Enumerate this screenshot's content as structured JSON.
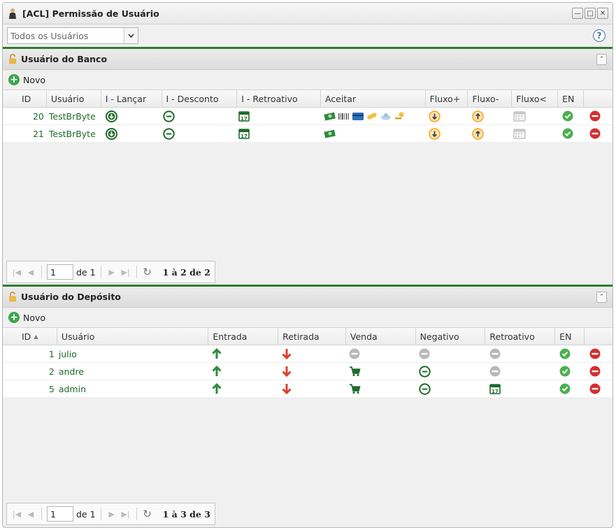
{
  "window": {
    "title": "[ACL] Permissão de Usuário",
    "icons": [
      "user-icon",
      "minimize-icon",
      "maximize-icon",
      "close-icon"
    ]
  },
  "toolbar": {
    "user_select_value": "Todos os Usuários",
    "help_label": "?"
  },
  "bank_panel": {
    "title": "Usuário do Banco",
    "new_label": "Novo",
    "columns": [
      "ID",
      "Usuário",
      "I - Lançar",
      "I - Desconto",
      "I - Retroativo",
      "Aceitar",
      "Fluxo+",
      "Fluxo-",
      "Fluxo<",
      "EN",
      ""
    ],
    "rows": [
      {
        "id": "20",
        "user": "TestBrByte",
        "aceitar_icons": [
          "money-icon",
          "barcode-icon",
          "card-icon",
          "pill-icon",
          "cloud-icon",
          "key-icon"
        ]
      },
      {
        "id": "21",
        "user": "TestBrByte",
        "aceitar_icons": [
          "money-icon"
        ]
      }
    ],
    "pager": {
      "page": "1",
      "of_label": "de 1",
      "summary": "1 à 2 de 2"
    }
  },
  "deposit_panel": {
    "title": "Usuário do Depósito",
    "new_label": "Novo",
    "columns": [
      "ID",
      "Usuário",
      "Entrada",
      "Retirada",
      "Venda",
      "Negativo",
      "Retroativo",
      "EN",
      ""
    ],
    "rows": [
      {
        "id": "1",
        "user": "julio",
        "venda": "disabled",
        "negativo": "disabled",
        "retroativo": "disabled"
      },
      {
        "id": "2",
        "user": "andre",
        "venda": "cart",
        "negativo": "minus",
        "retroativo": "disabled"
      },
      {
        "id": "5",
        "user": "admin",
        "venda": "cart",
        "negativo": "minus",
        "retroativo": "calendar"
      }
    ],
    "pager": {
      "page": "1",
      "of_label": "de 1",
      "summary": "1 à 3 de 3"
    }
  },
  "colors": {
    "accent_green": "#2e7d32",
    "ok_green": "#4caf50",
    "delete_red": "#d32f2f",
    "orange": "#f5a623"
  }
}
